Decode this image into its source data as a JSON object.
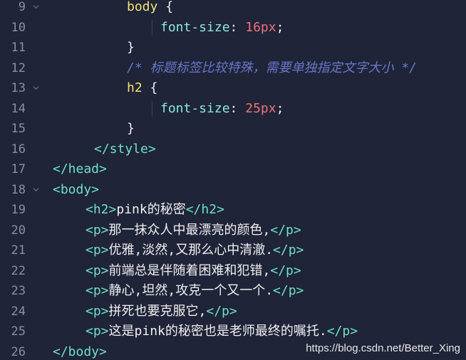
{
  "lines": [
    {
      "n": "9",
      "parts": [
        {
          "c": "sel",
          "t": "body"
        },
        {
          "c": "txt",
          "t": " {"
        }
      ]
    },
    {
      "n": "10",
      "parts": [
        {
          "c": "prop",
          "t": "font-size"
        },
        {
          "c": "txt",
          "t": ": "
        },
        {
          "c": "num",
          "t": "16px"
        },
        {
          "c": "txt",
          "t": ";"
        }
      ]
    },
    {
      "n": "11",
      "parts": [
        {
          "c": "txt",
          "t": "}"
        }
      ]
    },
    {
      "n": "12",
      "parts": [
        {
          "c": "comment",
          "t": "/* 标题标签比较特殊，需要单独指定文字大小 */"
        }
      ]
    },
    {
      "n": "13",
      "parts": [
        {
          "c": "sel",
          "t": "h2"
        },
        {
          "c": "txt",
          "t": " {"
        }
      ]
    },
    {
      "n": "14",
      "parts": [
        {
          "c": "prop",
          "t": "font-size"
        },
        {
          "c": "txt",
          "t": ": "
        },
        {
          "c": "num",
          "t": "25px"
        },
        {
          "c": "txt",
          "t": ";"
        }
      ]
    },
    {
      "n": "15",
      "parts": [
        {
          "c": "txt",
          "t": "}"
        }
      ]
    },
    {
      "n": "16",
      "parts": [
        {
          "c": "tag",
          "t": "</style>"
        }
      ]
    },
    {
      "n": "17",
      "parts": [
        {
          "c": "tag",
          "t": "</head>"
        }
      ]
    },
    {
      "n": "18",
      "parts": [
        {
          "c": "tag",
          "t": "<body>"
        }
      ]
    },
    {
      "n": "19",
      "parts": [
        {
          "c": "tag",
          "t": "<h2>"
        },
        {
          "c": "txt",
          "t": "pink的秘密"
        },
        {
          "c": "tag",
          "t": "</h2>"
        }
      ]
    },
    {
      "n": "20",
      "parts": [
        {
          "c": "tag",
          "t": "<p>"
        },
        {
          "c": "txt",
          "t": "那一抹众人中最漂亮的颜色,"
        },
        {
          "c": "tag",
          "t": "</p>"
        }
      ]
    },
    {
      "n": "21",
      "parts": [
        {
          "c": "tag",
          "t": "<p>"
        },
        {
          "c": "txt",
          "t": "优雅,淡然,又那么心中清澈."
        },
        {
          "c": "tag",
          "t": "</p>"
        }
      ]
    },
    {
      "n": "22",
      "parts": [
        {
          "c": "tag",
          "t": "<p>"
        },
        {
          "c": "txt",
          "t": "前端总是伴随着困难和犯错,"
        },
        {
          "c": "tag",
          "t": "</p>"
        }
      ]
    },
    {
      "n": "23",
      "parts": [
        {
          "c": "tag",
          "t": "<p>"
        },
        {
          "c": "txt",
          "t": "静心,坦然,攻克一个又一个."
        },
        {
          "c": "tag",
          "t": "</p>"
        }
      ]
    },
    {
      "n": "24",
      "parts": [
        {
          "c": "tag",
          "t": "<p>"
        },
        {
          "c": "txt",
          "t": "拼死也要克服它,"
        },
        {
          "c": "tag",
          "t": "</p>"
        }
      ]
    },
    {
      "n": "25",
      "parts": [
        {
          "c": "tag",
          "t": "<p>"
        },
        {
          "c": "txt",
          "t": "这是pink的秘密也是老师最终的嘱托."
        },
        {
          "c": "tag",
          "t": "</p>"
        }
      ]
    },
    {
      "n": "26",
      "parts": [
        {
          "c": "tag",
          "t": "</body>"
        }
      ]
    }
  ],
  "watermark": "https://blog.csdn.net/Better_Xing",
  "colors": {
    "background": "#1f2438",
    "tag": "#6fe0c8",
    "selector": "#f5e36f",
    "property": "#8be9e0",
    "number": "#f07178",
    "comment": "#6a76c9"
  }
}
